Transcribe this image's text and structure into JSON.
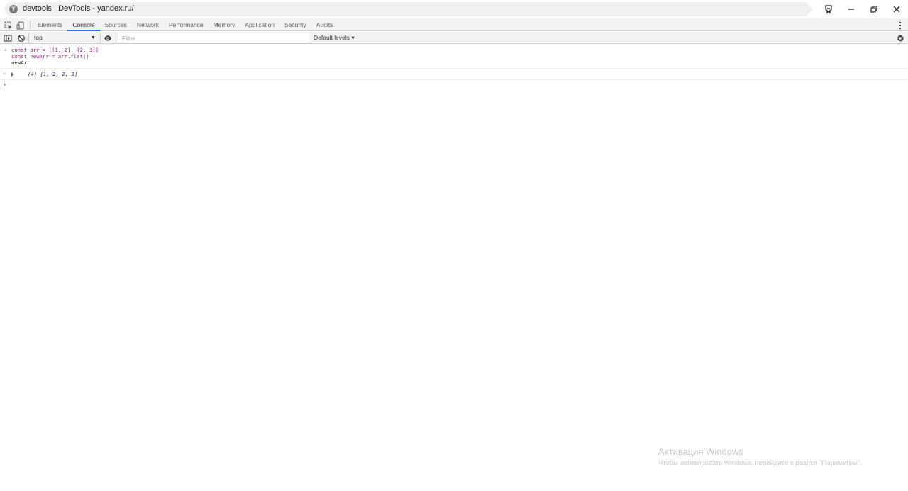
{
  "window": {
    "site_icon": "Y",
    "title": "devtools   DevTools - yandex.ru/",
    "buttons": [
      "pin-icon",
      "minimize-icon",
      "restore-icon",
      "close-icon"
    ]
  },
  "devtools": {
    "tabs": [
      "Elements",
      "Console",
      "Sources",
      "Network",
      "Performance",
      "Memory",
      "Application",
      "Security",
      "Audits"
    ],
    "active_tab": "Console"
  },
  "toolbar": {
    "context": "top",
    "filter_placeholder": "Filter",
    "levels": "Default levels ▾"
  },
  "console": {
    "input_lines": [
      "const arr = [[1, 2], [2, 3]]",
      "const newArr = arr.flat()",
      "newArr"
    ],
    "result_prefix": "(4) [",
    "result_values": [
      "1",
      "2",
      "2",
      "3"
    ],
    "result_suffix": "]"
  },
  "watermark": {
    "title": "Активация Windows",
    "subtitle": "Чтобы активировать Windows, перейдите в раздел \"Параметры\"."
  },
  "colors": {
    "accent": "#1a73e8",
    "keyword": "#aa0d91",
    "number": "#1c00cf"
  }
}
